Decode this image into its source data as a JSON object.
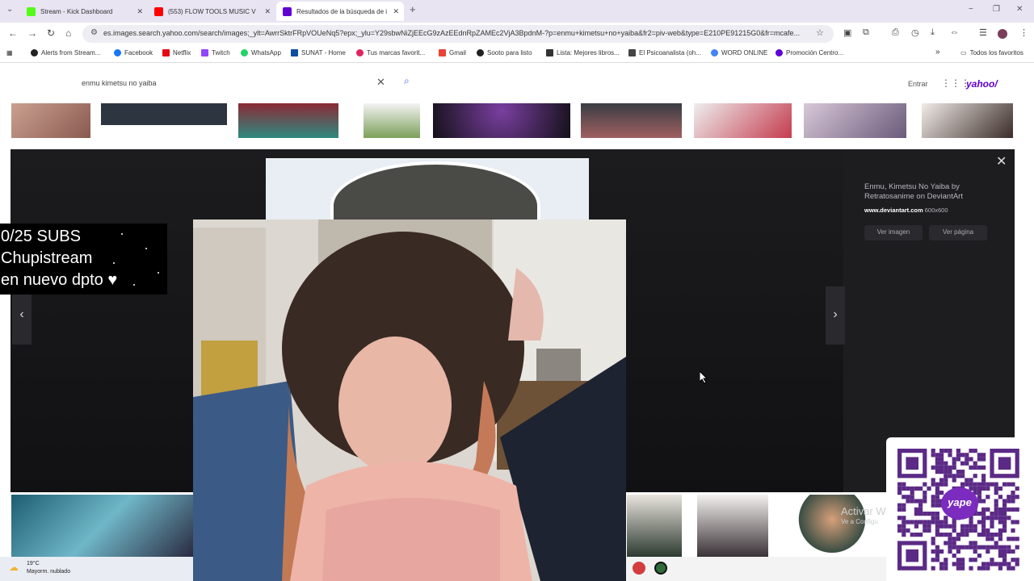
{
  "browser": {
    "tabs": [
      {
        "label": "Stream - Kick Dashboard",
        "active": false,
        "favicon_color": "#53fc18"
      },
      {
        "label": "(553) FLOW TOOLS MUSIC V",
        "active": false,
        "favicon_color": "#ff0000"
      },
      {
        "label": "Resultados de la búsqueda de i",
        "active": true,
        "favicon_color": "#6001d2"
      }
    ],
    "new_tab": "+",
    "window_controls": {
      "minimize": "−",
      "restore": "❐",
      "close": "✕"
    },
    "url": "es.images.search.yahoo.com/search/images;_ylt=AwrrSktrFRpVOUeNq5?epx;_ylu=Y29sbwNiZjEEcG9zAzEEdnRpZAMEc2VjA3BpdnM-?p=enmu+kimetsu+no+yaiba&fr2=piv-web&type=E210PE91215G0&fr=mcafe..."
  },
  "bookmarks": [
    {
      "label": "Alerts from Stream...",
      "color": "#222222"
    },
    {
      "label": "Facebook",
      "color": "#1877f2"
    },
    {
      "label": "Netflix",
      "color": "#e50914"
    },
    {
      "label": "Twitch",
      "color": "#9146ff"
    },
    {
      "label": "WhatsApp",
      "color": "#25d366"
    },
    {
      "label": "SUNAT - Home",
      "color": "#0b4ea2"
    },
    {
      "label": "Tus marcas favorit...",
      "color": "#e0245e"
    },
    {
      "label": "Gmail",
      "color": "#ea4335"
    },
    {
      "label": "Sooto para listo",
      "color": "#222222"
    },
    {
      "label": "Lista: Mejores libros...",
      "color": "#333333"
    },
    {
      "label": "El Psicoanalista (oh...",
      "color": "#444444"
    },
    {
      "label": "WORD ONLINE",
      "color": "#4285f4"
    },
    {
      "label": "Promoción Centro...",
      "color": "#6001d2"
    }
  ],
  "bookmarks_more": "»",
  "bookmarks_folder": "Todos los favoritos",
  "yahoo": {
    "search_value": "enmu kimetsu no yaiba",
    "clear_glyph": "✕",
    "search_glyph": "⌕",
    "signin_label": "Entrar",
    "logo": "yahoo/"
  },
  "viewer": {
    "title": "Enmu, Kimetsu No Yaiba by Retratosanime on DeviantArt",
    "source_site": "www.deviantart.com",
    "dimensions": "600x600",
    "view_image_label": "Ver imagen",
    "view_page_label": "Ver página",
    "close_glyph": "✕",
    "prev_glyph": "‹",
    "next_glyph": "›"
  },
  "overlay": {
    "line1": "0/25 SUBS",
    "line2": "Chupistream",
    "line3": "en nuevo dpto ♥"
  },
  "watermark": {
    "line1": "Activar W",
    "line2": "Ve a Configu"
  },
  "weather": {
    "temperature": "19°C",
    "description": "Mayorm. nublado"
  },
  "qr_brand": "yape"
}
